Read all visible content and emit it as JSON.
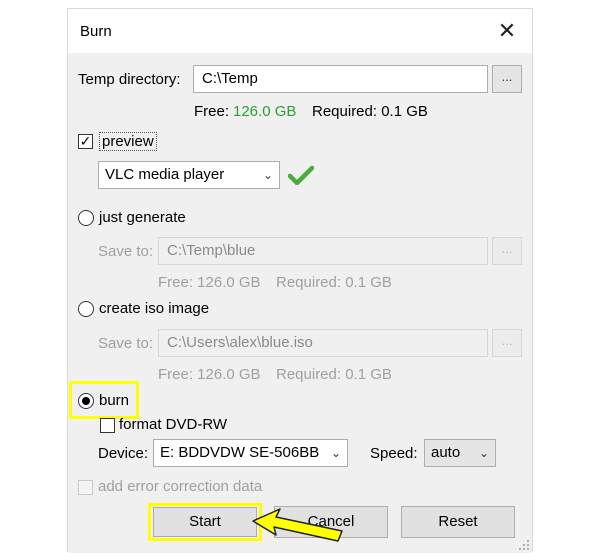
{
  "window": {
    "title": "Burn",
    "close_glyph": "✕"
  },
  "temp": {
    "label": "Temp directory:",
    "value": "C:\\Temp",
    "browse": "...",
    "free_label": "Free:",
    "free_value": "126.0 GB",
    "free_color": "#2e9e2e",
    "required": "Required: 0.1 GB"
  },
  "preview": {
    "label": "preview",
    "checked": "✓",
    "player": "VLC media player",
    "ok_icon": "green-checkmark-icon"
  },
  "just_generate": {
    "label": "just generate",
    "save_to_label": "Save to:",
    "path": "C:\\Temp\\blue",
    "browse": "...",
    "free": "Free: 126.0 GB",
    "required": "Required: 0.1 GB"
  },
  "iso": {
    "label": "create iso image",
    "save_to_label": "Save to:",
    "path": "C:\\Users\\alex\\blue.iso",
    "browse": "...",
    "free": "Free: 126.0 GB",
    "required": "Required: 0.1 GB"
  },
  "burn": {
    "label": "burn",
    "format_label": "format DVD-RW",
    "device_label": "Device:",
    "device_value": "E: BDDVDW SE-506BB",
    "speed_label": "Speed:",
    "speed_value": "auto"
  },
  "error_correction": {
    "label": "add error correction data"
  },
  "buttons": {
    "start": "Start",
    "cancel": "Cancel",
    "reset": "Reset"
  },
  "annotation_color": "#ffff00"
}
